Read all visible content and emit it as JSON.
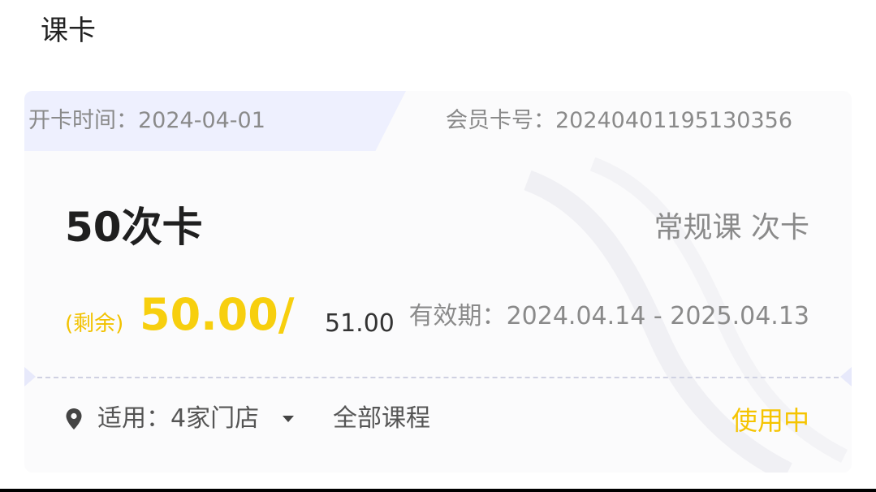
{
  "page": {
    "title": "课卡"
  },
  "card": {
    "open_date_label": "开卡时间：",
    "open_date": "2024-04-01",
    "card_number_label": "会员卡号：",
    "card_number": "20240401195130356",
    "name": "50次卡",
    "course_type": "常规课 次卡",
    "remaining_label": "(剩余)",
    "remaining_value": "50.00/",
    "total_value": "51.00",
    "validity_label": "有效期：",
    "validity_range": "2024.04.14 - 2025.04.13",
    "applicable_label": "适用：",
    "applicable_stores": "4家门店",
    "courses_scope": "全部课程",
    "status": "使用中"
  },
  "icons": {
    "location": "location-pin-icon",
    "dropdown": "caret-down-icon"
  },
  "colors": {
    "accent_yellow": "#f7cf0e",
    "header_tab": "#eef0fe",
    "muted_text": "#8a8a8a"
  }
}
